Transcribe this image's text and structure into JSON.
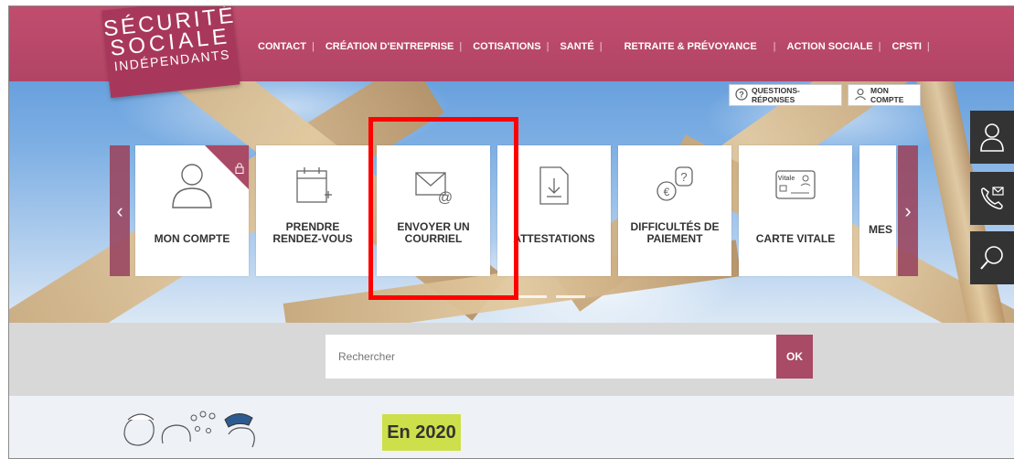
{
  "logo": {
    "line1": "SÉCURITÉ",
    "line2": "SOCIALE",
    "line3": "INDÉPENDANTS"
  },
  "nav": [
    "CONTACT",
    "CRÉATION D'ENTREPRISE",
    "COTISATIONS",
    "SANTÉ",
    "RETRAITE & PRÉVOYANCE",
    "ACTION SOCIALE",
    "CPSTI"
  ],
  "nav_separator": "|",
  "utility": {
    "faq": "QUESTIONS-RÉPONSES",
    "account": "MON COMPTE"
  },
  "cards": [
    {
      "label": "MON COMPTE",
      "icon": "user-icon"
    },
    {
      "label": "PRENDRE RENDEZ-VOUS",
      "icon": "calendar-icon"
    },
    {
      "label": "ENVOYER UN COURRIEL",
      "icon": "email-icon"
    },
    {
      "label": "ATTESTATIONS",
      "icon": "download-document-icon"
    },
    {
      "label": "DIFFICULTÉS DE PAIEMENT",
      "icon": "euro-question-icon"
    },
    {
      "label": "CARTE VITALE",
      "icon": "vitale-card-icon",
      "card_text": "Vitale"
    },
    {
      "label": "MES",
      "icon": "partial-card"
    }
  ],
  "search": {
    "placeholder": "Rechercher",
    "button": "OK"
  },
  "banner": {
    "year": "En 2020"
  },
  "colors": {
    "brand": "#b14466",
    "accent_dark": "#a94a66",
    "highlight": "#ff0000",
    "badge": "#cddf4a"
  }
}
